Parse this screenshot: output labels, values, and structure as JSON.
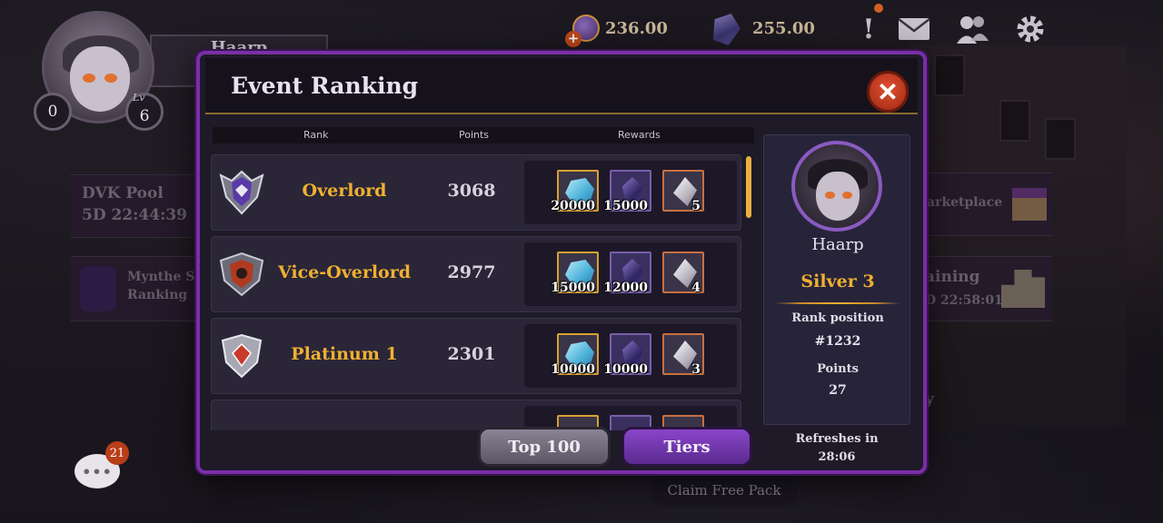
{
  "hud": {
    "player_name_bg": "Haarp",
    "trophies": "0",
    "level_tag": "Lv",
    "level": "6",
    "currency_coins": "236.00",
    "currency_gems": "255.00"
  },
  "side_panels": {
    "pool_title": "DVK Pool",
    "pool_timer": "5D 22:44:39",
    "ranking_line1": "Mynthe S",
    "ranking_line2": "Ranking",
    "marketplace": "arketplace",
    "training": "aining",
    "training_timer": "D 22:58:01",
    "partial_right": "y"
  },
  "chat": {
    "badge_count": "21"
  },
  "claim_pack": {
    "label": "Claim Free Pack"
  },
  "modal": {
    "title": "Event Ranking",
    "columns": {
      "rank": "Rank",
      "points": "Points",
      "rewards": "Rewards"
    },
    "rows": [
      {
        "rank": "Overlord",
        "points": "3068",
        "rewards": [
          "20000",
          "15000",
          "5"
        ]
      },
      {
        "rank": "Vice-Overlord",
        "points": "2977",
        "rewards": [
          "15000",
          "12000",
          "4"
        ]
      },
      {
        "rank": "Platinum 1",
        "points": "2301",
        "rewards": [
          "10000",
          "10000",
          "3"
        ]
      }
    ],
    "buttons": {
      "top100": "Top 100",
      "tiers": "Tiers"
    }
  },
  "player_card": {
    "name": "Haarp",
    "tier": "Silver 3",
    "rank_position_label": "Rank position",
    "rank_position": "#1232",
    "points_label": "Points",
    "points": "27",
    "refresh_label": "Refreshes in",
    "refresh_time": "28:06"
  },
  "colors": {
    "accent_purple": "#7a2ea8",
    "rank_gold": "#f0b030",
    "close_red": "#c83820",
    "tiers_button": "#7a3eb8",
    "top100_button": "#6e6878"
  },
  "icons": [
    "coin-icon",
    "gem-icon",
    "alert-icon",
    "mail-icon",
    "friends-icon",
    "gear-icon",
    "close-icon",
    "chat-icon",
    "blue-crystal-icon",
    "purple-crystal-icon",
    "white-crystal-icon"
  ]
}
